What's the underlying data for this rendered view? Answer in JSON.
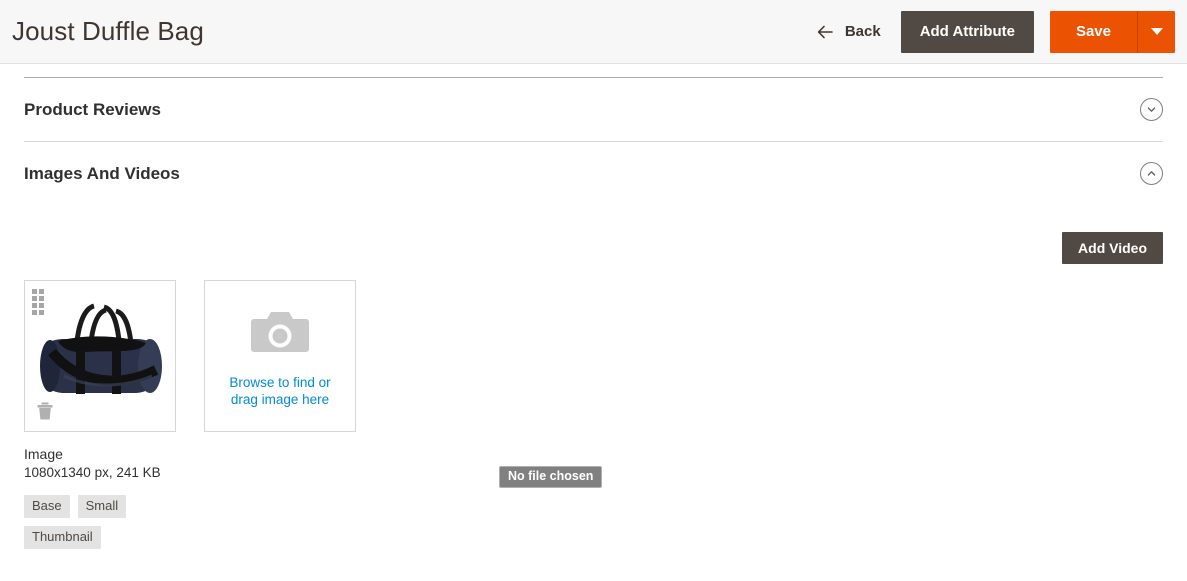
{
  "header": {
    "title": "Joust Duffle Bag",
    "back_label": "Back",
    "back_icon": "arrow-left-icon",
    "add_attribute_label": "Add Attribute",
    "save_label": "Save",
    "save_dropdown_icon": "caret-down-icon",
    "accent_color": "#eb5202",
    "secondary_color": "#514943",
    "background_color": "#f7f7f7"
  },
  "sections": [
    {
      "title": "Product Reviews",
      "expanded": false,
      "toggle_icon": "chevron-down-circle-icon"
    },
    {
      "title": "Images And Videos",
      "expanded": true,
      "toggle_icon": "chevron-up-circle-icon"
    }
  ],
  "gallery": {
    "add_video_label": "Add Video",
    "image_card": {
      "alt": "navy duffle bag",
      "drag_handle_icon": "drag-handle-icon",
      "delete_icon": "trash-icon"
    },
    "upload_card": {
      "camera_icon": "camera-icon",
      "prompt_line1": "Browse to find or",
      "prompt_line2": "drag image here",
      "link_color": "#008bdb"
    },
    "image_meta": {
      "label": "Image",
      "dimensions": "1080x1340 px, 241 KB",
      "roles": [
        "Base",
        "Small",
        "Thumbnail"
      ]
    }
  },
  "file_chooser": {
    "status_text": "No file chosen"
  }
}
